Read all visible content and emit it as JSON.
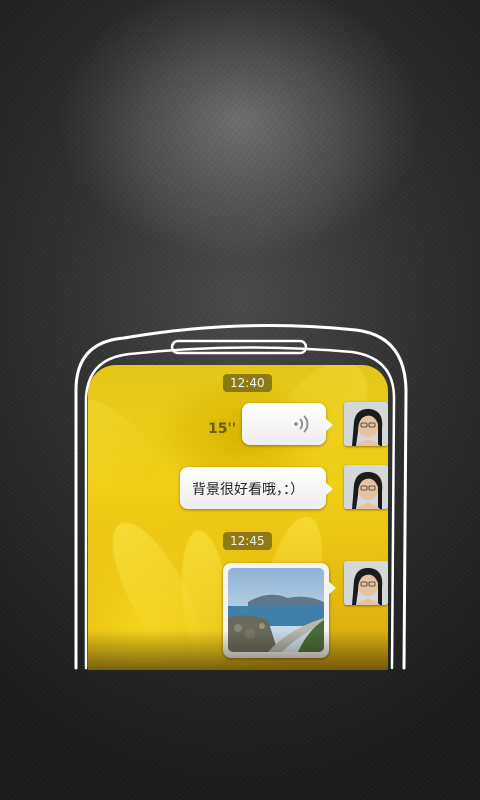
{
  "conversation": {
    "timestamps": [
      "12:40",
      "12:45"
    ],
    "voice_message": {
      "duration": "15''",
      "icon": "voice-wave-icon"
    },
    "text_message": "背景很好看哦，：）",
    "image_message": {
      "icon": "photo-thumbnail"
    }
  },
  "colors": {
    "background": "#2b2b2b",
    "chat_background": "#f0cf16",
    "bubble": "#ffffff",
    "outline": "#ffffff"
  }
}
